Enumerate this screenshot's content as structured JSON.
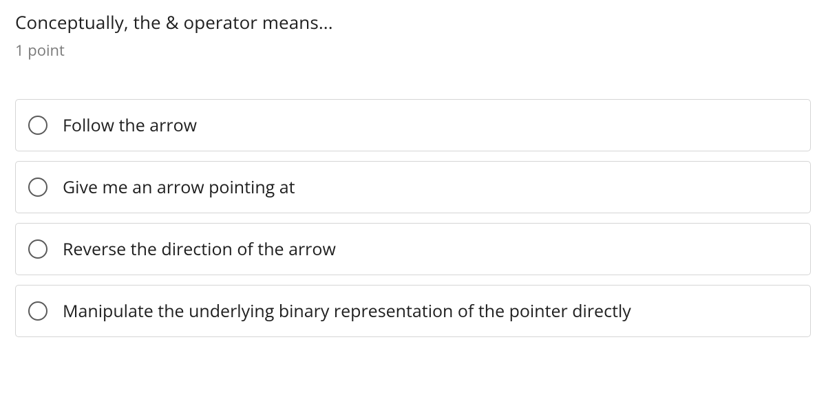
{
  "question": {
    "title": "Conceptually, the & operator means...",
    "points": "1 point"
  },
  "options": [
    {
      "label": "Follow the arrow"
    },
    {
      "label": "Give me an arrow pointing at"
    },
    {
      "label": "Reverse the direction of the arrow"
    },
    {
      "label": "Manipulate the underlying binary representation of the pointer directly"
    }
  ]
}
